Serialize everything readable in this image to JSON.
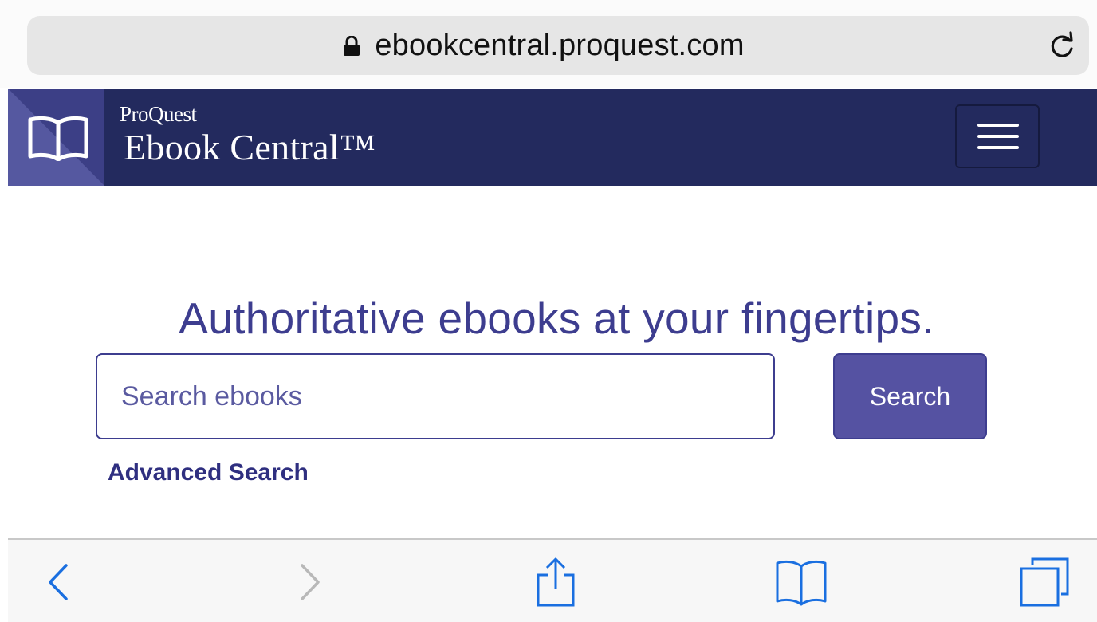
{
  "browser": {
    "url": "ebookcentral.proquest.com",
    "icons": [
      "lock-icon",
      "reload-icon"
    ]
  },
  "header": {
    "brand_small": "ProQuest",
    "brand_large": "Ebook Central™",
    "logo_icon": "open-book-icon",
    "menu_icon": "hamburger-menu-icon",
    "colors": {
      "header_bg": "#232a5e",
      "logo_bg": "#4c4f95"
    }
  },
  "main": {
    "tagline": "Authoritative ebooks at your fingertips.",
    "search": {
      "placeholder": "Search ebooks",
      "value": "",
      "button_label": "Search"
    },
    "advanced_search_label": "Advanced Search",
    "colors": {
      "accent": "#3d3d8f",
      "button_bg": "#5552a2"
    }
  },
  "toolbar": {
    "items": [
      "back-icon",
      "forward-icon",
      "share-icon",
      "bookmarks-icon",
      "tabs-icon"
    ],
    "colors": {
      "active": "#1a6fe0",
      "disabled": "#b8b8b8"
    }
  }
}
